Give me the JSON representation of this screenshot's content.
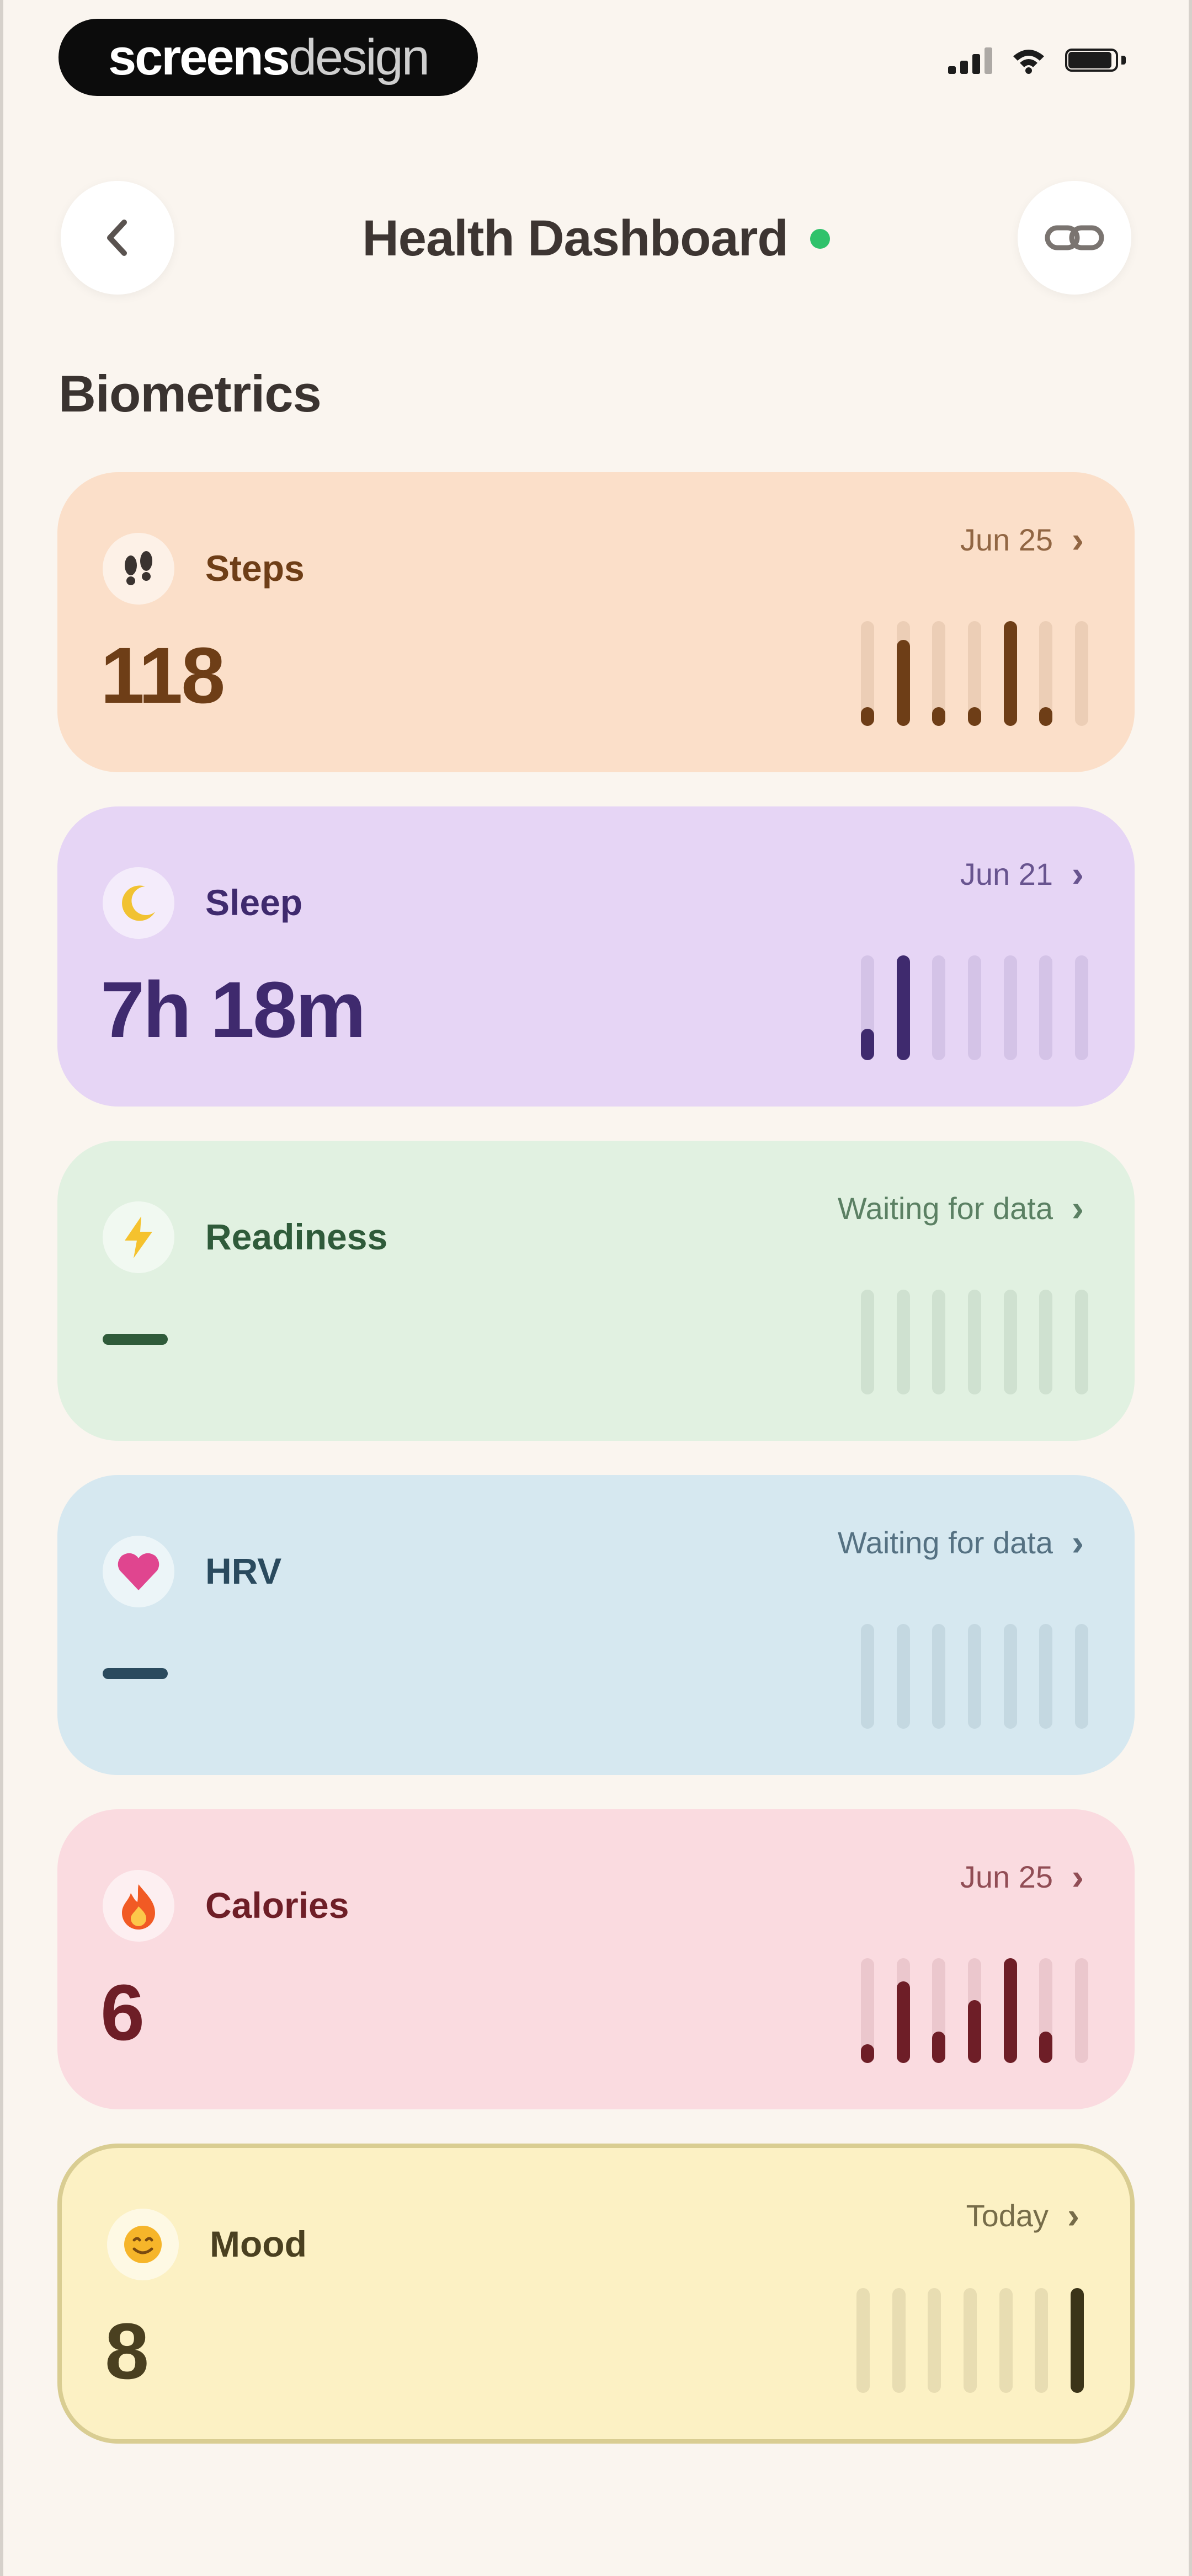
{
  "status_bar": {
    "brand_bold": "screens",
    "brand_light": "design"
  },
  "header": {
    "title": "Health Dashboard",
    "back_icon": "chevron-left-icon",
    "link_icon": "link-icon",
    "live_color": "#2fc26b"
  },
  "section": {
    "title": "Biometrics"
  },
  "cards": [
    {
      "label": "Steps",
      "meta": "Jun 25",
      "value": "118",
      "icon": "footprints-icon",
      "bg": "#fbdfc9",
      "text_color": "#6e3e17",
      "bar_color": "#6e3e17",
      "bars": [
        0.18,
        0.82,
        0.18,
        0.18,
        1.0,
        0.18,
        0
      ]
    },
    {
      "label": "Sleep",
      "meta": "Jun 21",
      "value": "7h 18m",
      "icon": "moon-icon",
      "bg": "#e6d5f5",
      "text_color": "#3f2a6e",
      "bar_color": "#3f2a6e",
      "bars": [
        0.3,
        1.0,
        0,
        0,
        0,
        0,
        0
      ]
    },
    {
      "label": "Readiness",
      "meta": "Waiting for data",
      "value": "",
      "icon": "bolt-icon",
      "bg": "#e1f1e1",
      "text_color": "#2f5b3a",
      "bar_color": "#2f5b3a",
      "bars": [
        0,
        0,
        0,
        0,
        0,
        0,
        0
      ]
    },
    {
      "label": "HRV",
      "meta": "Waiting for data",
      "value": "",
      "icon": "heart-icon",
      "bg": "#d6e8f0",
      "text_color": "#2a4a5e",
      "bar_color": "#2a4a5e",
      "bars": [
        0,
        0,
        0,
        0,
        0,
        0,
        0
      ]
    },
    {
      "label": "Calories",
      "meta": "Jun 25",
      "value": "6",
      "icon": "flame-icon",
      "bg": "#fadbe0",
      "text_color": "#6e1e27",
      "bar_color": "#6e1e27",
      "bars": [
        0.18,
        0.78,
        0.3,
        0.6,
        1.0,
        0.3,
        0
      ]
    },
    {
      "label": "Mood",
      "meta": "Today",
      "value": "8",
      "icon": "smile-icon",
      "bg": "#fcf1c4",
      "text_color": "#4a4020",
      "bar_color": "#3b3418",
      "bars": [
        0,
        0,
        0,
        0,
        0,
        0,
        1.0
      ]
    }
  ]
}
